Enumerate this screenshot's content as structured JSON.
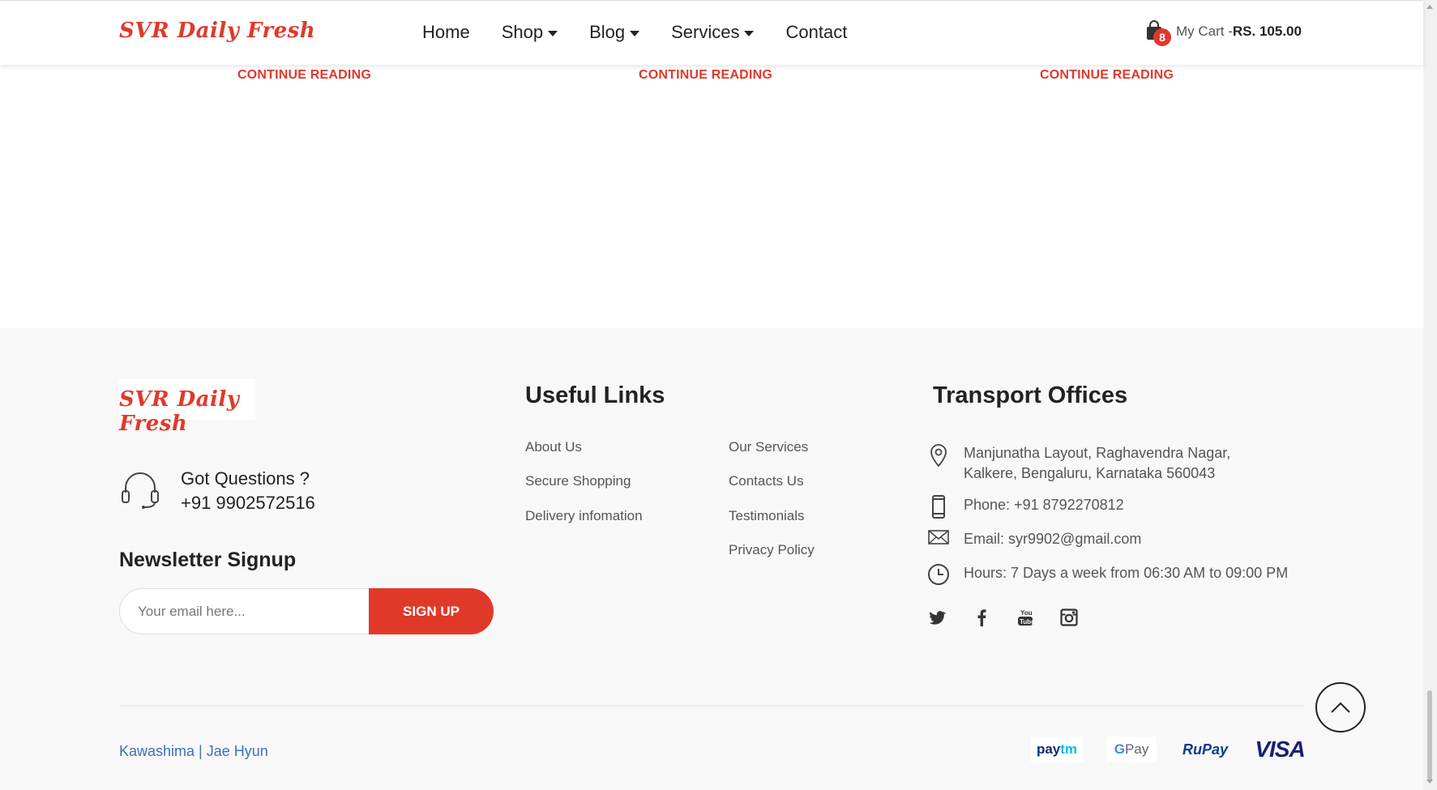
{
  "header": {
    "logo": "SVR Daily Fresh",
    "nav": [
      {
        "label": "Home",
        "dropdown": false
      },
      {
        "label": "Shop",
        "dropdown": true
      },
      {
        "label": "Blog",
        "dropdown": true
      },
      {
        "label": "Services",
        "dropdown": true
      },
      {
        "label": "Contact",
        "dropdown": false
      }
    ],
    "cart": {
      "count": "8",
      "label": "My Cart -",
      "price": "RS. 105.00"
    }
  },
  "blog": {
    "continue_labels": [
      "CONTINUE READING",
      "CONTINUE READING",
      "CONTINUE READING"
    ]
  },
  "footer": {
    "logo": "SVR Daily Fresh",
    "help": {
      "title": "Got Questions ?",
      "phone": "+91 9902572516"
    },
    "newsletter": {
      "title": "Newsletter Signup",
      "placeholder": "Your email here...",
      "button": "SIGN UP"
    },
    "useful_links": {
      "title": "Useful Links",
      "col1": [
        "About Us",
        "Secure Shopping",
        "Delivery infomation"
      ],
      "col2": [
        "Our Services",
        "Contacts Us",
        "Testimonials",
        "Privacy Policy"
      ]
    },
    "transport": {
      "title": "Transport Offices",
      "address": "Manjunatha Layout, Raghavendra Nagar, Kalkere, Bengaluru, Karnataka 560043",
      "phone": "Phone: +91 8792270812",
      "email": "Email: syr9902@gmail.com",
      "hours": "Hours: 7 Days a week from 06:30 AM to 09:00 PM"
    },
    "social": [
      "twitter-icon",
      "facebook-icon",
      "youtube-icon",
      "instagram-icon"
    ],
    "credit": "Kawashima | Jae Hyun",
    "payments": {
      "paytm_a": "pay",
      "paytm_b": "tm",
      "gpay_a": "G",
      "gpay_b": " Pay",
      "rupay": "RuPay",
      "visa": "VISA"
    }
  },
  "colors": {
    "accent": "#e0392a",
    "footer_bg": "#f8f8f8",
    "link_blue": "#3a72b8"
  }
}
